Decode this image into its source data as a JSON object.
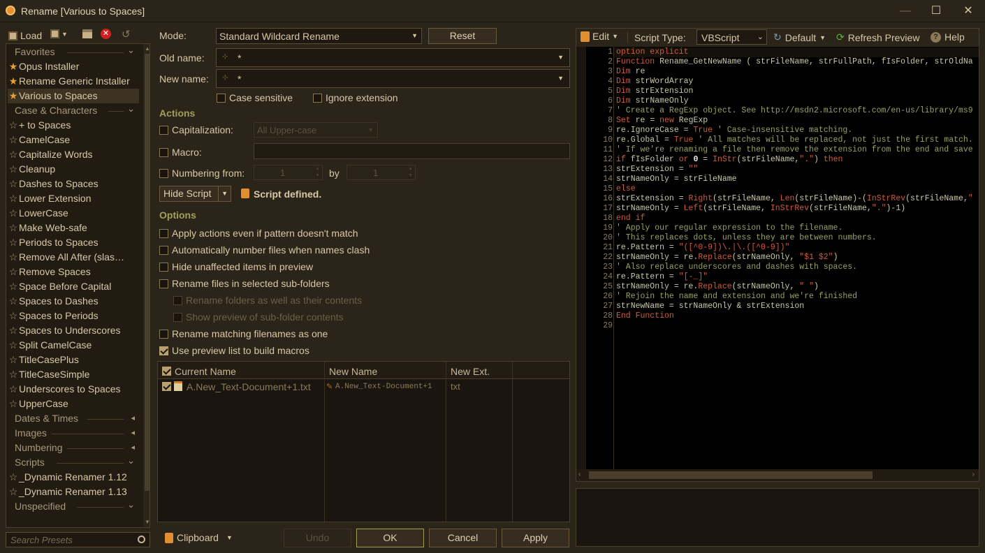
{
  "window": {
    "title": "Rename [Various to Spaces]",
    "minimize": "—",
    "maximize": "☐",
    "close": "✕"
  },
  "toolbar": {
    "load": "Load"
  },
  "sidebar": {
    "items": [
      {
        "type": "cat",
        "label": "Favorites",
        "arrow": "v"
      },
      {
        "type": "item",
        "label": "Opus Installer",
        "star": "full"
      },
      {
        "type": "item",
        "label": "Rename Generic Installer",
        "star": "full"
      },
      {
        "type": "item",
        "label": "Various to Spaces",
        "star": "full",
        "selected": true
      },
      {
        "type": "cat",
        "label": "Case & Characters",
        "arrow": "v"
      },
      {
        "type": "item",
        "label": "+ to Spaces",
        "star": "empty"
      },
      {
        "type": "item",
        "label": "CamelCase",
        "star": "empty"
      },
      {
        "type": "item",
        "label": "Capitalize Words",
        "star": "empty"
      },
      {
        "type": "item",
        "label": "Cleanup",
        "star": "empty"
      },
      {
        "type": "item",
        "label": "Dashes to Spaces",
        "star": "empty"
      },
      {
        "type": "item",
        "label": "Lower Extension",
        "star": "empty"
      },
      {
        "type": "item",
        "label": "LowerCase",
        "star": "empty"
      },
      {
        "type": "item",
        "label": "Make Web-safe",
        "star": "empty"
      },
      {
        "type": "item",
        "label": "Periods to Spaces",
        "star": "empty"
      },
      {
        "type": "item",
        "label": "Remove All After (slas…",
        "star": "empty"
      },
      {
        "type": "item",
        "label": "Remove Spaces",
        "star": "empty"
      },
      {
        "type": "item",
        "label": "Space Before Capital",
        "star": "empty"
      },
      {
        "type": "item",
        "label": "Spaces to Dashes",
        "star": "empty"
      },
      {
        "type": "item",
        "label": "Spaces to Periods",
        "star": "empty"
      },
      {
        "type": "item",
        "label": "Spaces to Underscores",
        "star": "empty"
      },
      {
        "type": "item",
        "label": "Split CamelCase",
        "star": "empty"
      },
      {
        "type": "item",
        "label": "TitleCasePlus",
        "star": "empty"
      },
      {
        "type": "item",
        "label": "TitleCaseSimple",
        "star": "empty"
      },
      {
        "type": "item",
        "label": "Underscores to Spaces",
        "star": "empty"
      },
      {
        "type": "item",
        "label": "UpperCase",
        "star": "empty"
      },
      {
        "type": "cat",
        "label": "Dates & Times",
        "arrow": "<"
      },
      {
        "type": "cat",
        "label": "Images",
        "arrow": "<"
      },
      {
        "type": "cat",
        "label": "Numbering",
        "arrow": "<"
      },
      {
        "type": "cat",
        "label": "Scripts",
        "arrow": "v"
      },
      {
        "type": "item",
        "label": "_Dynamic Renamer 1.12",
        "star": "empty"
      },
      {
        "type": "item",
        "label": "_Dynamic Renamer 1.13",
        "star": "empty"
      },
      {
        "type": "cat",
        "label": "Unspecified",
        "arrow": "v"
      }
    ],
    "search_placeholder": "Search Presets"
  },
  "form": {
    "mode_label": "Mode:",
    "mode_value": "Standard Wildcard Rename",
    "reset": "Reset",
    "old_label": "Old name:",
    "old_value": "*",
    "new_label": "New name:",
    "new_value": "*",
    "case_sensitive": "Case sensitive",
    "ignore_ext": "Ignore extension",
    "actions": "Actions",
    "capitalization": "Capitalization:",
    "cap_value": "All Upper-case",
    "macro": "Macro:",
    "numbering": "Numbering from:",
    "num_from": "1",
    "by": "by",
    "num_by": "1",
    "hide_script": "Hide Script",
    "script_defined": "Script defined.",
    "options": "Options",
    "opt1": "Apply actions even if pattern doesn't match",
    "opt2": "Automatically number files when names clash",
    "opt3": "Hide unaffected items in preview",
    "opt4": "Rename files in selected sub-folders",
    "opt5": "Rename folders as well as their contents",
    "opt6": "Show preview of sub-folder contents",
    "opt7": "Rename matching filenames as one",
    "opt8": "Use preview list to build macros"
  },
  "grid": {
    "headers": [
      "Current Name",
      "New Name",
      "New Ext."
    ],
    "rows": [
      {
        "current": "A.New_Text-Document+1.txt",
        "new": "A.New_Text-Document+1",
        "ext": "txt"
      }
    ]
  },
  "bottom": {
    "clipboard": "Clipboard",
    "undo": "Undo",
    "ok": "OK",
    "cancel": "Cancel",
    "apply": "Apply"
  },
  "editor": {
    "edit": "Edit",
    "script_type_label": "Script Type:",
    "script_type": "VBScript",
    "default": "Default",
    "refresh": "Refresh Preview",
    "help": "Help",
    "lines": [
      [
        [
          "kw",
          "option explicit"
        ]
      ],
      [
        [
          "kw",
          "Function"
        ],
        [
          "id",
          " Rename_GetNewName ( strFileName, strFullPath, fIsFolder, strOldNa"
        ]
      ],
      [
        [
          "kw",
          "Dim"
        ],
        [
          "id",
          " re"
        ]
      ],
      [
        [
          "kw",
          "Dim"
        ],
        [
          "id",
          " strWordArray"
        ]
      ],
      [
        [
          "kw",
          "Dim"
        ],
        [
          "id",
          " strExtension"
        ]
      ],
      [
        [
          "kw",
          "Dim"
        ],
        [
          "id",
          " strNameOnly"
        ]
      ],
      [
        [
          "cm",
          "' Create a RegExp object. See http://msdn2.microsoft.com/en-us/library/ms9"
        ]
      ],
      [
        [
          "kw",
          "Set"
        ],
        [
          "id",
          " re = "
        ],
        [
          "kw",
          "new"
        ],
        [
          "id",
          " RegExp"
        ]
      ],
      [
        [
          "id",
          "re.IgnoreCase = "
        ],
        [
          "kw",
          "True"
        ],
        [
          "cm",
          " ' Case-insensitive matching."
        ]
      ],
      [
        [
          "id",
          "re.Global = "
        ],
        [
          "kw",
          "True"
        ],
        [
          "cm",
          " ' All matches will be replaced, not just the first match."
        ]
      ],
      [
        [
          "cm",
          "' If we're renaming a file then remove the extension from the end and save"
        ]
      ],
      [
        [
          "kw",
          "if"
        ],
        [
          "id",
          " fIsFolder "
        ],
        [
          "kw",
          "or"
        ],
        [
          "num",
          " 0"
        ],
        [
          "id",
          " = "
        ],
        [
          "kw",
          "InStr"
        ],
        [
          "id",
          "(strFileName,"
        ],
        [
          "str",
          "\".\""
        ],
        [
          "id",
          ") "
        ],
        [
          "kw",
          "then"
        ]
      ],
      [
        [
          "id",
          "strExtension = "
        ],
        [
          "str",
          "\"\""
        ]
      ],
      [
        [
          "id",
          "strNameOnly = strFileName"
        ]
      ],
      [
        [
          "kw",
          "else"
        ]
      ],
      [
        [
          "id",
          "strExtension = "
        ],
        [
          "kw",
          "Right"
        ],
        [
          "id",
          "(strFileName, "
        ],
        [
          "kw",
          "Len"
        ],
        [
          "id",
          "(strFileName)-("
        ],
        [
          "kw",
          "InStrRev"
        ],
        [
          "id",
          "(strFileName,"
        ],
        [
          "str",
          "\""
        ]
      ],
      [
        [
          "id",
          "strNameOnly = "
        ],
        [
          "kw",
          "Left"
        ],
        [
          "id",
          "(strFileName, "
        ],
        [
          "kw",
          "InStrRev"
        ],
        [
          "id",
          "(strFileName,"
        ],
        [
          "str",
          "\".\""
        ],
        [
          "id",
          ")-1)"
        ]
      ],
      [
        [
          "kw",
          "end if"
        ]
      ],
      [
        [
          "cm",
          "' Apply our regular expression to the filename."
        ]
      ],
      [
        [
          "cm",
          "' This replaces dots, unless they are between numbers."
        ]
      ],
      [
        [
          "id",
          "re.Pattern = "
        ],
        [
          "str",
          "\"([^0-9])\\.|\\.([^0-9])\""
        ]
      ],
      [
        [
          "id",
          "strNameOnly = re."
        ],
        [
          "kw",
          "Replace"
        ],
        [
          "id",
          "(strNameOnly, "
        ],
        [
          "str",
          "\"$1 $2\""
        ],
        [
          "id",
          ")"
        ]
      ],
      [
        [
          "cm",
          "' Also replace underscores and dashes with spaces."
        ]
      ],
      [
        [
          "id",
          "re.Pattern = "
        ],
        [
          "str",
          "\"[-_]\""
        ]
      ],
      [
        [
          "id",
          "strNameOnly = re."
        ],
        [
          "kw",
          "Replace"
        ],
        [
          "id",
          "(strNameOnly, "
        ],
        [
          "str",
          "\" \""
        ],
        [
          "id",
          ")"
        ]
      ],
      [
        [
          "cm",
          "' Rejoin the name and extension and we're finished"
        ]
      ],
      [
        [
          "id",
          "strNewName = strNameOnly & strExtension"
        ]
      ],
      [
        [
          "kw",
          "End Function"
        ]
      ],
      []
    ]
  }
}
